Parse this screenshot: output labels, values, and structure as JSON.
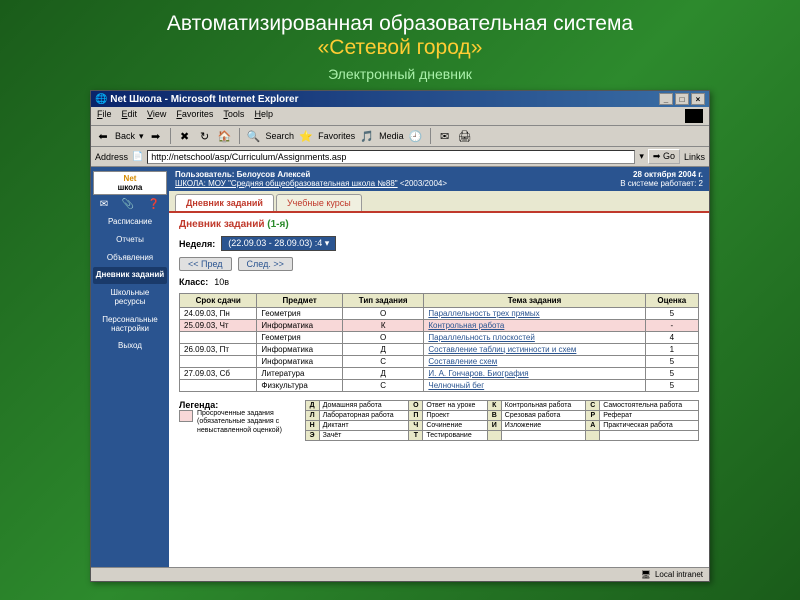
{
  "slide": {
    "title_pre": "Автоматизированная образовательная система",
    "title_accent": "«Сетевой город»",
    "subtitle": "Электронный дневник"
  },
  "browser": {
    "title": "Net Школа - Microsoft Internet Explorer",
    "menu": [
      "File",
      "Edit",
      "View",
      "Favorites",
      "Tools",
      "Help"
    ],
    "toolbar": {
      "back": "Back",
      "search": "Search",
      "fav": "Favorites",
      "media": "Media"
    },
    "addr_label": "Address",
    "addr_value": "http://netschool/asp/Curriculum/Assignments.asp",
    "go": "Go",
    "links": "Links",
    "status": "Local intranet"
  },
  "sidebar": {
    "logo1": "Net",
    "logo2": "школа",
    "items": [
      {
        "label": "Расписание"
      },
      {
        "label": "Отчеты"
      },
      {
        "label": "Объявления"
      },
      {
        "label": "Дневник заданий"
      },
      {
        "label": "Школьные ресурсы"
      },
      {
        "label": "Персональные настройки"
      },
      {
        "label": "Выход"
      }
    ]
  },
  "userbar": {
    "user_label": "Пользователь:",
    "user_name": "Белоусов Алексей",
    "school": "ШКОЛА: МОУ \"Средняя общеобразовательная школа №88\"",
    "year": "<2003/2004>",
    "date": "28 октября 2004 г.",
    "online": "В системе работает: 2"
  },
  "tabs": [
    {
      "label": "Дневник заданий"
    },
    {
      "label": "Учебные курсы"
    }
  ],
  "page": {
    "title": "Дневник заданий",
    "title_suffix": "(1-я)",
    "week_label": "Неделя:",
    "week_value": "(22.09.03 - 28.09.03) :4",
    "prev": "<< Пред",
    "next": "След. >>",
    "class_label": "Класс:",
    "class_value": "10в"
  },
  "table": {
    "headers": [
      "Срок сдачи",
      "Предмет",
      "Тип задания",
      "Тема задания",
      "Оценка"
    ],
    "rows": [
      {
        "date": "24.09.03, Пн",
        "subj": "Геометрия",
        "type": "О",
        "topic": "Параллельность трех прямых",
        "grade": "5",
        "overdue": false
      },
      {
        "date": "25.09.03, Чт",
        "subj": "Информатика",
        "type": "К",
        "topic": "Контрольная работа",
        "grade": "-",
        "overdue": true
      },
      {
        "date": "",
        "subj": "Геометрия",
        "type": "О",
        "topic": "Параллельность плоскостей",
        "grade": "4",
        "overdue": false
      },
      {
        "date": "26.09.03, Пт",
        "subj": "Информатика",
        "type": "Д",
        "topic": "Составление таблиц истинности и схем",
        "grade": "1",
        "overdue": false
      },
      {
        "date": "",
        "subj": "Информатика",
        "type": "С",
        "topic": "Составление схем",
        "grade": "5",
        "overdue": false
      },
      {
        "date": "27.09.03, Сб",
        "subj": "Литература",
        "type": "Д",
        "topic": "И. А. Гончаров. Биография",
        "grade": "5",
        "overdue": false
      },
      {
        "date": "",
        "subj": "Физкультура",
        "type": "С",
        "topic": "Челночный бег",
        "grade": "5",
        "overdue": false
      }
    ]
  },
  "legend": {
    "title": "Легенда:",
    "overdue_text": "Просроченные задания (обязательные задания с невыставленной оценкой)",
    "codes": [
      [
        {
          "c": "Д",
          "t": "Домашняя работа"
        },
        {
          "c": "О",
          "t": "Ответ на уроке"
        },
        {
          "c": "К",
          "t": "Контрольная работа"
        },
        {
          "c": "С",
          "t": "Самостоятельна работа"
        }
      ],
      [
        {
          "c": "Л",
          "t": "Лабораторная работа"
        },
        {
          "c": "П",
          "t": "Проект"
        },
        {
          "c": "В",
          "t": "Срезовая работа"
        },
        {
          "c": "Р",
          "t": "Реферат"
        }
      ],
      [
        {
          "c": "Н",
          "t": "Диктант"
        },
        {
          "c": "Ч",
          "t": "Сочинение"
        },
        {
          "c": "И",
          "t": "Изложение"
        },
        {
          "c": "А",
          "t": "Практическая работа"
        }
      ],
      [
        {
          "c": "Э",
          "t": "Зачёт"
        },
        {
          "c": "Т",
          "t": "Тестирование"
        },
        {
          "c": "",
          "t": ""
        },
        {
          "c": "",
          "t": ""
        }
      ]
    ]
  }
}
